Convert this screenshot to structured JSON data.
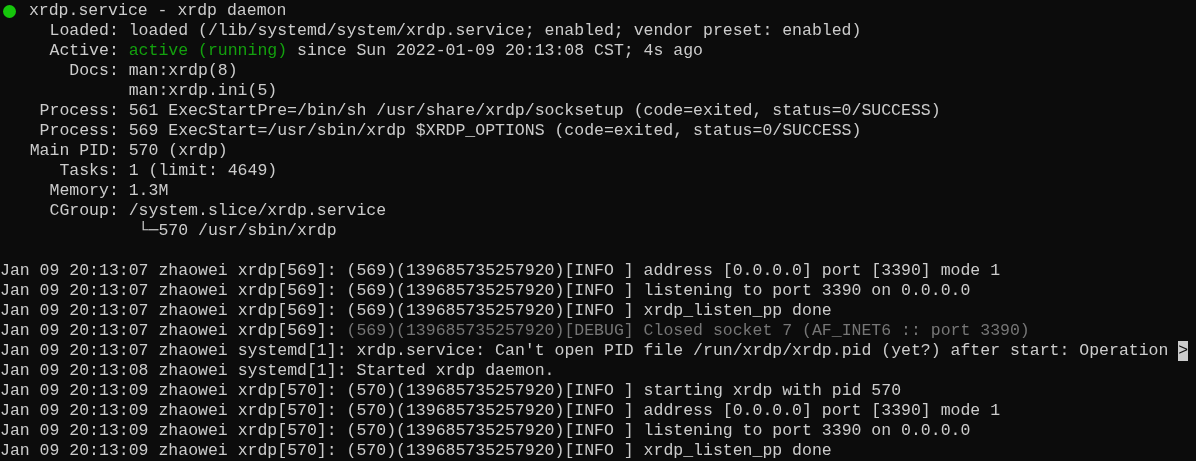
{
  "unit": {
    "active": true,
    "title": "xrdp.service - xrdp daemon"
  },
  "fields": [
    {
      "label": "Loaded:",
      "value": "loaded (/lib/systemd/system/xrdp.service; enabled; vendor preset: enabled)"
    },
    {
      "label": "Active:",
      "status": "active (running)",
      "value": " since Sun 2022-01-09 20:13:08 CST; 4s ago"
    },
    {
      "label": "Docs:",
      "value": "man:xrdp(8)",
      "more": [
        "man:xrdp.ini(5)"
      ]
    },
    {
      "label": "Process:",
      "value": "561 ExecStartPre=/bin/sh /usr/share/xrdp/socksetup (code=exited, status=0/SUCCESS)"
    },
    {
      "label": "Process:",
      "value": "569 ExecStart=/usr/sbin/xrdp $XRDP_OPTIONS (code=exited, status=0/SUCCESS)"
    },
    {
      "label": "Main PID:",
      "value": "570 (xrdp)"
    },
    {
      "label": "Tasks:",
      "value": "1 (limit: 4649)"
    },
    {
      "label": "Memory:",
      "value": "1.3M"
    },
    {
      "label": "CGroup:",
      "value": "/system.slice/xrdp.service",
      "children": [
        {
          "value": "└─570 /usr/sbin/xrdp"
        }
      ]
    }
  ],
  "log": [
    {
      "source": "Jan 09 20:13:07 zhaowei xrdp[569]:",
      "message": "(569)(139685735257920)[INFO ] address [0.0.0.0] port [3390] mode 1",
      "dimmed": false
    },
    {
      "source": "Jan 09 20:13:07 zhaowei xrdp[569]:",
      "message": "(569)(139685735257920)[INFO ] listening to port 3390 on 0.0.0.0",
      "dimmed": false
    },
    {
      "source": "Jan 09 20:13:07 zhaowei xrdp[569]:",
      "message": "(569)(139685735257920)[INFO ] xrdp_listen_pp done",
      "dimmed": false
    },
    {
      "source": "Jan 09 20:13:07 zhaowei xrdp[569]:",
      "message": "(569)(139685735257920)[DEBUG] Closed socket 7 (AF_INET6 :: port 3390)",
      "dimmed": true
    },
    {
      "source": "Jan 09 20:13:07 zhaowei systemd[1]:",
      "message": "xrdp.service: Can't open PID file /run/xrdp/xrdp.pid (yet?) after start: Operation",
      "dimmed": false,
      "overflow_marker": ">"
    },
    {
      "source": "Jan 09 20:13:08 zhaowei systemd[1]:",
      "message": "Started xrdp daemon.",
      "dimmed": false
    },
    {
      "source": "Jan 09 20:13:09 zhaowei xrdp[570]:",
      "message": "(570)(139685735257920)[INFO ] starting xrdp with pid 570",
      "dimmed": false
    },
    {
      "source": "Jan 09 20:13:09 zhaowei xrdp[570]:",
      "message": "(570)(139685735257920)[INFO ] address [0.0.0.0] port [3390] mode 1",
      "dimmed": false
    },
    {
      "source": "Jan 09 20:13:09 zhaowei xrdp[570]:",
      "message": "(570)(139685735257920)[INFO ] listening to port 3390 on 0.0.0.0",
      "dimmed": false
    },
    {
      "source": "Jan 09 20:13:09 zhaowei xrdp[570]:",
      "message": "(570)(139685735257920)[INFO ] xrdp_listen_pp done",
      "dimmed": false
    }
  ]
}
